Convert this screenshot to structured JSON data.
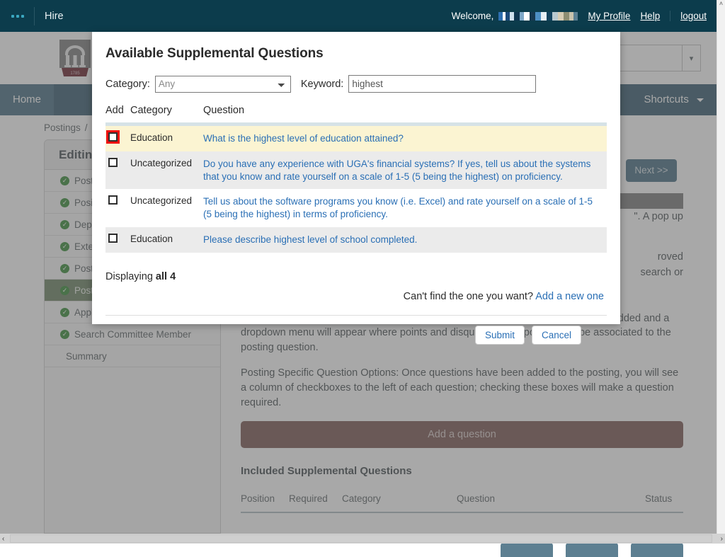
{
  "topbar": {
    "menu_icon": "grid-dots-icon",
    "brand": "Hire",
    "welcome": "Welcome,",
    "username_redacted": "",
    "my_profile": "My Profile",
    "help": "Help",
    "logout": "logout"
  },
  "header": {
    "logo_alt": "uga-arch-logo",
    "logo_year": "1785",
    "search_placeholder": ""
  },
  "mainnav": {
    "items": [
      {
        "label": "Home",
        "active": true
      },
      {
        "label": "Shortcuts",
        "active": false,
        "caret": true
      }
    ]
  },
  "breadcrumb": {
    "item1": "Postings",
    "sep": "/"
  },
  "leftrail": {
    "title": "Editing",
    "items": [
      {
        "label": "Post",
        "checked": true,
        "current": false
      },
      {
        "label": "Posi",
        "checked": true,
        "current": false
      },
      {
        "label": "Dep",
        "checked": true,
        "current": false
      },
      {
        "label": "Exte",
        "checked": true,
        "current": false
      },
      {
        "label": "Post",
        "checked": true,
        "current": false
      },
      {
        "label": "Post",
        "checked": true,
        "current": true
      },
      {
        "label": "Appl",
        "checked": true,
        "current": false
      },
      {
        "label": "Search Committee Member",
        "checked": true,
        "current": false
      },
      {
        "label": "Summary",
        "checked": false,
        "current": false
      }
    ],
    "check_glyph": "✓"
  },
  "content": {
    "next_button": "Next >>",
    "para_tail_1": "\". A pop up",
    "para_tail_2": "roved",
    "para_tail_3": "search or",
    "para_assign": "To Assign Points or Disqualifying Responses: Click on the question that has been added and a dropdown menu will appear where points and disqualifying responses can be associated to the posting question.",
    "para_options": "Posting Specific Question Options: Once questions have been added to the posting, you will see a column of checkboxes to the left of each question; checking these boxes will make a question required.",
    "add_question_button": "Add a question",
    "included_title": "Included Supplemental Questions",
    "included_columns": [
      "Position",
      "Required",
      "Category",
      "Question",
      "Status"
    ]
  },
  "modal": {
    "title": "Available Supplemental Questions",
    "category_label": "Category:",
    "category_value": "Any",
    "category_options": [
      "Any"
    ],
    "keyword_label": "Keyword:",
    "keyword_value": "highest",
    "columns": {
      "add": "Add",
      "category": "Category",
      "question": "Question"
    },
    "rows": [
      {
        "category": "Education",
        "question": "What is the highest level of education attained?",
        "checked": false,
        "focused": true,
        "style": "sel"
      },
      {
        "category": "Uncategorized",
        "question": "Do you have any experience with UGA's financial systems? If yes, tell us about the systems that you know and rate yourself on a scale of 1-5 (5 being the highest) on proficiency.",
        "checked": false,
        "focused": false,
        "style": "alt"
      },
      {
        "category": "Uncategorized",
        "question": "Tell us about the software programs you know (i.e. Excel) and rate yourself on a scale of 1-5 (5 being the highest) in terms of proficiency.",
        "checked": false,
        "focused": false,
        "style": "white"
      },
      {
        "category": "Education",
        "question": "Please describe highest level of school completed.",
        "checked": false,
        "focused": false,
        "style": "alt"
      }
    ],
    "displaying_prefix": "Displaying ",
    "displaying_count": "all 4",
    "find_text": "Can't find the one you want? ",
    "find_link": "Add a new one",
    "submit_label": "Submit",
    "cancel_label": "Cancel"
  },
  "scrollbars": {
    "left_arrow": "‹",
    "right_arrow": "›",
    "up_arrow": "˄"
  },
  "colors": {
    "topbar_bg": "#0c3c4c",
    "nav_bg": "#4e6f80",
    "link_blue": "#2a6fb5",
    "selected_row": "#fbf4d2",
    "focus_red": "#ee1111",
    "add_question_btn": "#8a6a66",
    "rail_current": "#7e9276"
  }
}
